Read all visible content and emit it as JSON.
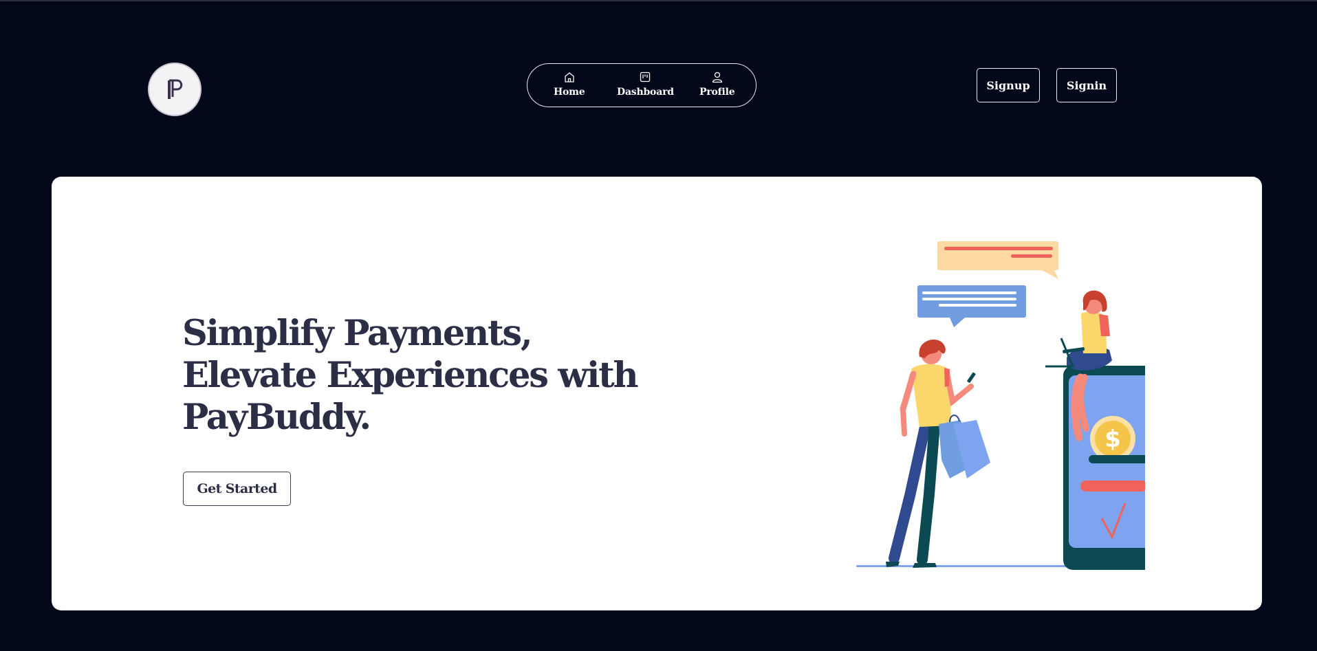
{
  "header": {
    "logo": {
      "letter": "P",
      "icon": "paybuddy-logo"
    },
    "nav": [
      {
        "label": "Home",
        "icon": "home-icon"
      },
      {
        "label": "Dashboard",
        "icon": "dashboard-icon"
      },
      {
        "label": "Profile",
        "icon": "user-icon"
      }
    ],
    "signup_label": "Signup",
    "signin_label": "Signin"
  },
  "hero": {
    "headline_lines": [
      "Simplify Payments,",
      "Elevate Experiences with",
      "PayBuddy."
    ],
    "cta_label": "Get Started",
    "illustration": "payment-shopping-illustration",
    "phone_icon": "dollar-coin-icon"
  },
  "colors": {
    "background": "#03071a",
    "hero_card": "#ffffff",
    "heading_text": "#2c2e45",
    "accent_red": "#f0625a",
    "phone_body": "#0b4a52",
    "phone_screen": "#7ea3ef",
    "coin": "#f5c54a"
  }
}
